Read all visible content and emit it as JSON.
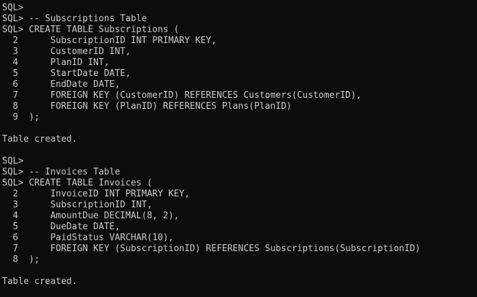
{
  "console": {
    "lines": [
      "SQL>",
      "SQL> -- Subscriptions Table",
      "SQL> CREATE TABLE Subscriptions (",
      "  2      SubscriptionID INT PRIMARY KEY,",
      "  3      CustomerID INT,",
      "  4      PlanID INT,",
      "  5      StartDate DATE,",
      "  6      EndDate DATE,",
      "  7      FOREIGN KEY (CustomerID) REFERENCES Customers(CustomerID),",
      "  8      FOREIGN KEY (PlanID) REFERENCES Plans(PlanID)",
      "  9  );",
      "",
      "Table created.",
      "",
      "SQL>",
      "SQL> -- Invoices Table",
      "SQL> CREATE TABLE Invoices (",
      "  2      InvoiceID INT PRIMARY KEY,",
      "  3      SubscriptionID INT,",
      "  4      AmountDue DECIMAL(8, 2),",
      "  5      DueDate DATE,",
      "  6      PaidStatus VARCHAR(10),",
      "  7      FOREIGN KEY (SubscriptionID) REFERENCES Subscriptions(SubscriptionID)",
      "  8  );",
      "",
      "Table created."
    ]
  },
  "colors": {
    "background": "#0c0c0c",
    "text": "#cccccc"
  }
}
